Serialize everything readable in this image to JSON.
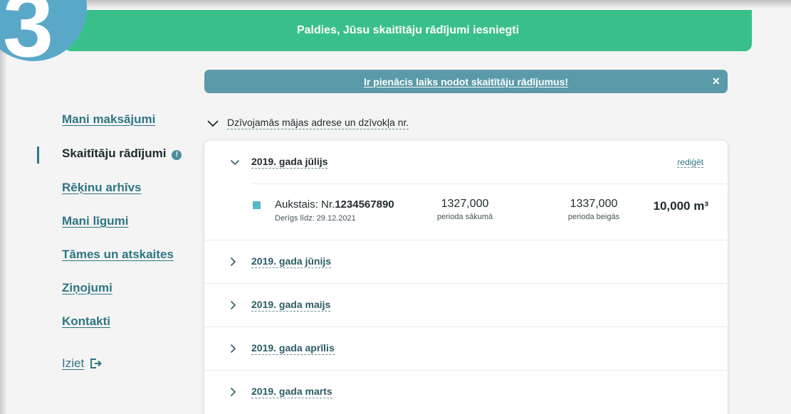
{
  "step_badge": "3",
  "banner": {
    "message": "Paldies, Jūsu skaitītāju rādījumi iesniegti"
  },
  "alert": {
    "message": "Ir pienācis laiks nodot skaitītāju rādījumus!",
    "close_glyph": "×"
  },
  "sidebar": {
    "items": [
      {
        "label": "Mani maksājumi"
      },
      {
        "label": "Skaitītāju rādījumi",
        "active": true,
        "info_glyph": "!"
      },
      {
        "label": "Rēķinu arhīvs"
      },
      {
        "label": "Mani līgumi"
      },
      {
        "label": "Tāmes un atskaites"
      },
      {
        "label": "Ziņojumi"
      },
      {
        "label": "Kontakti"
      }
    ],
    "logout_label": "Iziet"
  },
  "address_section": {
    "label": "Dzīvojamās mājas adrese un dzīvokļa nr."
  },
  "months": [
    {
      "label": "2019. gada jūlijs",
      "expanded": true,
      "edit_label": "rediģēt",
      "meter": {
        "type_label": "Aukstais: Nr.",
        "number": "1234567890",
        "valid_until": "Derīgs līdz: 29.12.2021",
        "start_value": "1327,000",
        "start_label": "perioda sākumā",
        "end_value": "1337,000",
        "end_label": "perioda beigās",
        "consumption": "10,000 m³",
        "indicator_color": "#55b8c8"
      }
    },
    {
      "label": "2019. gada jūnijs",
      "expanded": false
    },
    {
      "label": "2019. gada maijs",
      "expanded": false
    },
    {
      "label": "2019. gada aprīlis",
      "expanded": false
    },
    {
      "label": "2019. gada marts",
      "expanded": false
    }
  ],
  "colors": {
    "success_green": "#39c08a",
    "alert_teal": "#5b9aa8",
    "link_teal": "#2f7584",
    "badge_blue": "#5aa8c7"
  },
  "icons": {
    "expand": "chevron-down-icon",
    "collapse": "chevron-right-icon",
    "logout": "logout-icon",
    "info": "info-icon",
    "close": "close-icon"
  }
}
